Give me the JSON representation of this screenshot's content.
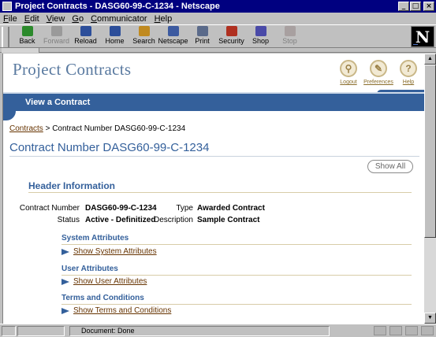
{
  "window": {
    "title": "Project Contracts - DASG60-99-C-1234 - Netscape",
    "controls": [
      "_",
      "□",
      "×"
    ]
  },
  "menu": [
    "File",
    "Edit",
    "View",
    "Go",
    "Communicator",
    "Help"
  ],
  "toolbar": {
    "buttons": [
      {
        "label": "Back",
        "icon": "back-arrow-icon",
        "color": "#2c8a2c",
        "enabled": true
      },
      {
        "label": "Forward",
        "icon": "forward-arrow-icon",
        "color": "#9a9a9a",
        "enabled": false
      },
      {
        "label": "Reload",
        "icon": "reload-icon",
        "color": "#2c4e9a",
        "enabled": true
      },
      {
        "label": "Home",
        "icon": "home-icon",
        "color": "#2c4e9a",
        "enabled": true
      },
      {
        "label": "Search",
        "icon": "search-icon",
        "color": "#c08a20",
        "enabled": true
      },
      {
        "label": "Netscape",
        "icon": "netscape-icon",
        "color": "#3c5aa0",
        "enabled": true
      },
      {
        "label": "Print",
        "icon": "print-icon",
        "color": "#5a6a8a",
        "enabled": true
      },
      {
        "label": "Security",
        "icon": "lock-icon",
        "color": "#b03020",
        "enabled": true
      },
      {
        "label": "Shop",
        "icon": "shop-bag-icon",
        "color": "#4a4aa8",
        "enabled": true
      },
      {
        "label": "Stop",
        "icon": "stop-icon",
        "color": "#a8a0a0",
        "enabled": false
      }
    ],
    "logo_letter": "N"
  },
  "header": {
    "brand": "Project Contracts",
    "icons": [
      {
        "label": "Logout",
        "glyph": "⚲",
        "icon": "logout-key-icon"
      },
      {
        "label": "Preferences",
        "glyph": "✎",
        "icon": "preferences-icon"
      },
      {
        "label": "Help",
        "glyph": "?",
        "icon": "help-icon"
      }
    ],
    "banner_title": "View a Contract",
    "banner_color": "#34609b"
  },
  "breadcrumb": {
    "link": "Contracts",
    "separator": " > ",
    "current": "Contract Number DASG60-99-C-1234"
  },
  "page_title": "Contract Number DASG60-99-C-1234",
  "show_all_label": "Show All",
  "header_info": {
    "title": "Header Information",
    "fields": {
      "contract_number_label": "Contract Number",
      "contract_number": "DASG60-99-C-1234",
      "type_label": "Type",
      "type": "Awarded Contract",
      "status_label": "Status",
      "status": "Active - Definitized",
      "description_label": "Description",
      "description": "Sample Contract"
    }
  },
  "subsections": [
    {
      "title": "System Attributes",
      "link": "Show System Attributes"
    },
    {
      "title": "User Attributes",
      "link": "Show User Attributes"
    },
    {
      "title": "Terms and Conditions",
      "link": "Show Terms and Conditions"
    }
  ],
  "statusbar": {
    "text": "Document: Done"
  }
}
